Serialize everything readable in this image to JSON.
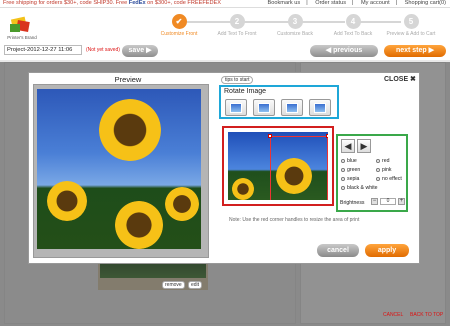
{
  "promo": {
    "text_a": "Free shipping for orders $30+, code SHIP30. Free ",
    "brand": "FedEx",
    "text_b": " on $300+, code FREEFEDEX"
  },
  "toplinks": [
    "Bookmark us",
    "Order status",
    "My account",
    "Shopping cart(0)"
  ],
  "logo_text": "Printer's Brand",
  "steps": [
    {
      "num": "✔",
      "label": "Customize Front"
    },
    {
      "num": "2",
      "label": "Add Text To Front"
    },
    {
      "num": "3",
      "label": "Customize Back"
    },
    {
      "num": "4",
      "label": "Add Text To Back"
    },
    {
      "num": "5",
      "label": "Preview & Add to Cart"
    }
  ],
  "project": {
    "name": "Project-2012-12-27 11:06",
    "status": "(Not yet saved)",
    "save": "save"
  },
  "nav": {
    "previous": "previous",
    "next": "next step"
  },
  "modal": {
    "preview_title": "Preview",
    "tips": "tips to start",
    "close": "CLOSE ✖",
    "rotate_title": "Rotate Image",
    "effects": [
      "blue",
      "red",
      "green",
      "pink",
      "sepia",
      "no effect",
      "black & white"
    ],
    "brightness_label": "Brightness",
    "brightness_value": "0",
    "note": "Note: Use the red corner handles to resize the area of print",
    "cancel": "cancel",
    "apply": "apply"
  },
  "under": {
    "remove": "remove",
    "edit": "edit"
  },
  "footer": {
    "cancel": "CANCEL",
    "back_to_top": "BACK TO TOP"
  },
  "colors": {
    "accent": "#f08a24",
    "rotate_border": "#1ea7d8",
    "crop_border": "#d21f1f",
    "effects_border": "#3aa84a"
  }
}
